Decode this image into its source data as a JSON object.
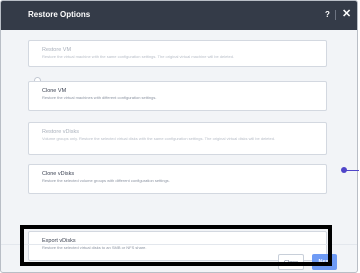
{
  "dialog": {
    "title": "Restore Options",
    "help_label": "?",
    "close_label": "✕"
  },
  "options": [
    {
      "title": "Restore VM",
      "description": "Restore the virtual machine with the same configuration settings. The original virtual machine will be deleted.",
      "disabled": true,
      "selected": false
    },
    {
      "title": "Clone VM",
      "description": "Restore the virtual machines with different configuration settings.",
      "disabled": false,
      "selected": false
    },
    {
      "title": "Restore vDisks",
      "description": "Volume groups only. Restore the selected virtual disks with the same configuration settings. The original virtual disks will be deleted.",
      "disabled": true,
      "selected": false
    },
    {
      "title": "Clone vDisks",
      "description": "Restore the selected volume groups with different configuration settings.",
      "disabled": false,
      "selected": false
    },
    {
      "title": "Export vDisks",
      "description": "Restore the selected virtual disks to an SMB or NFS share.",
      "disabled": false,
      "selected": true
    }
  ],
  "footer": {
    "close_label": "Close",
    "next_label": "Next"
  },
  "colors": {
    "header_bg": "#343b48",
    "accent": "#3a6fe0",
    "next_button": "#6f9bf5",
    "highlight_box": "#000000",
    "annotation": "#4f45c9"
  }
}
